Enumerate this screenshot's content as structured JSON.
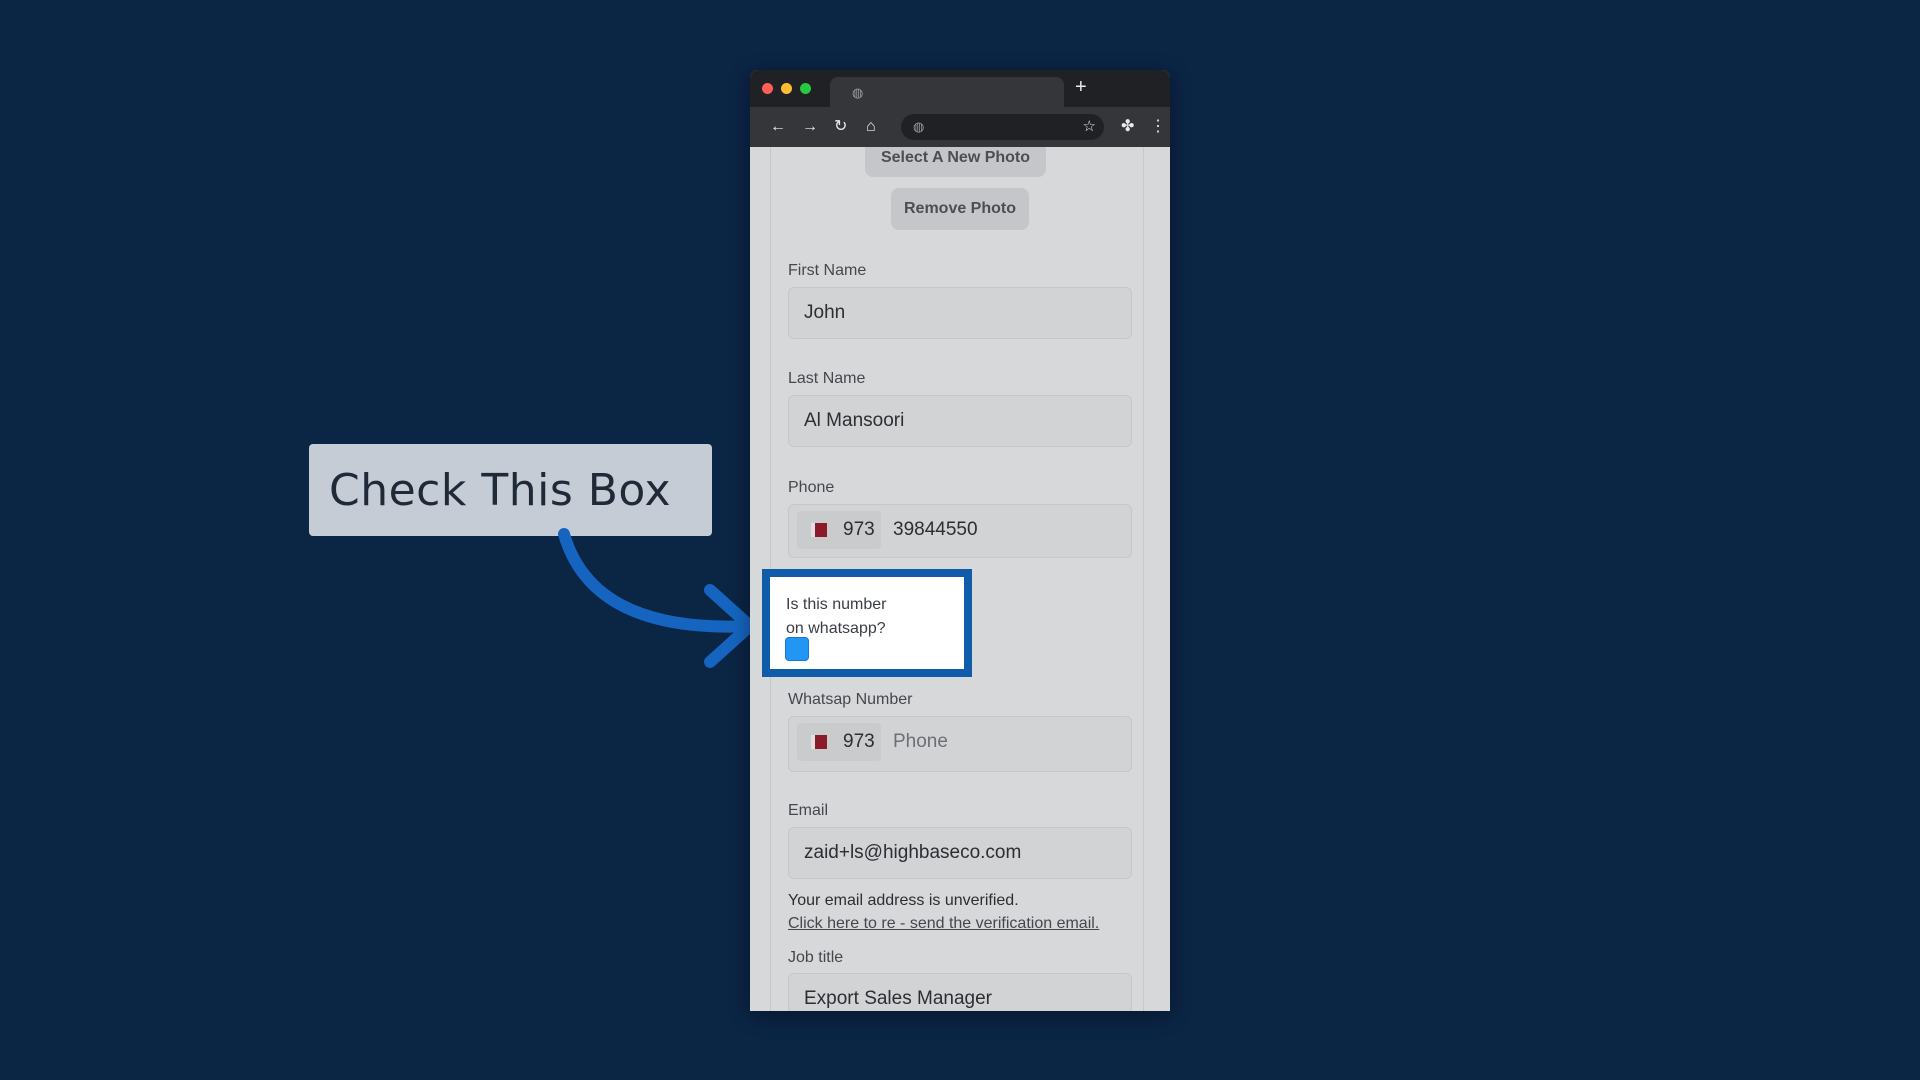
{
  "callout": {
    "text": "Check This Box"
  },
  "browser": {
    "new_tab_symbol": "+",
    "icons": [
      "globe-icon",
      "back-icon",
      "forward-icon",
      "reload-icon",
      "home-icon",
      "star-icon",
      "extensions-icon",
      "menu-icon"
    ]
  },
  "form": {
    "select_photo_label": "Select A New Photo",
    "remove_photo_label": "Remove Photo",
    "first_name": {
      "label": "First Name",
      "value": "John"
    },
    "last_name": {
      "label": "Last Name",
      "value": "Al Mansoori"
    },
    "phone": {
      "label": "Phone",
      "country_code": "973",
      "value": "39844550"
    },
    "whatsapp_question": {
      "line1": "Is this number",
      "line2": "on whatsapp?"
    },
    "whatsapp": {
      "label": "Whatsap Number",
      "country_code": "973",
      "placeholder": "Phone"
    },
    "email": {
      "label": "Email",
      "value": "zaid+ls@highbaseco.com",
      "unverified_note": "Your email address is unverified.",
      "resend_link": "Click here to re - send the verification email."
    },
    "job_title": {
      "label": "Job title",
      "value": "Export Sales Manager"
    }
  },
  "colors": {
    "background": "#0b2545",
    "highlight": "#0f5cab",
    "checkbox": "#2196f3"
  }
}
